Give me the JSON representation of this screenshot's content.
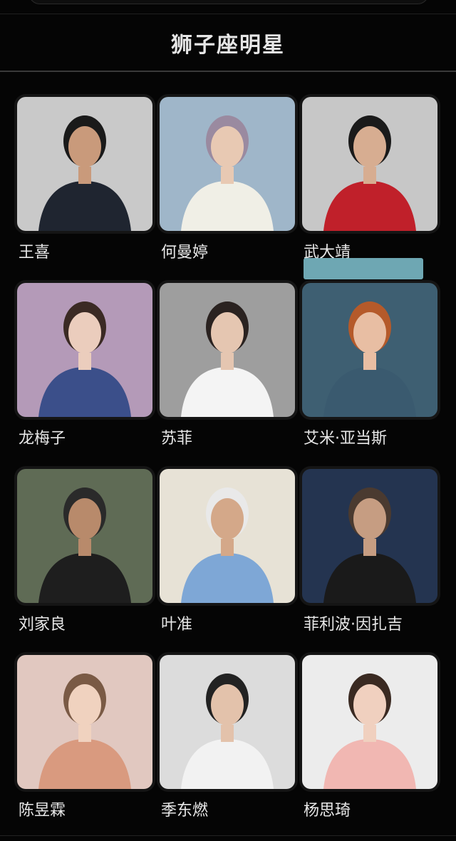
{
  "header": {
    "title": "狮子座明星"
  },
  "celebrities": [
    {
      "name": "王喜",
      "bg": "#c9c9c9",
      "cloth": "#1f2530",
      "skin": "#c99a7b",
      "hair": "#1a1a1a"
    },
    {
      "name": "何曼婷",
      "bg": "#9fb6c9",
      "cloth": "#f0efe6",
      "skin": "#e8c9b3",
      "hair": "#9a8aa0"
    },
    {
      "name": "武大靖",
      "bg": "#c7c7c7",
      "cloth": "#c0202a",
      "skin": "#d7ad91",
      "hair": "#1a1a1a"
    },
    {
      "name": "龙梅子",
      "bg": "#b49ab8",
      "cloth": "#3b4f8a",
      "skin": "#ebcdbd",
      "hair": "#3b2a24"
    },
    {
      "name": "苏菲",
      "bg": "#9e9e9e",
      "cloth": "#f4f4f4",
      "skin": "#e5c6b1",
      "hair": "#2a2220"
    },
    {
      "name": "艾米·亚当斯",
      "bg": "#3e5f72",
      "cloth": "#3a5a6f",
      "skin": "#e8bea3",
      "hair": "#b55a2a"
    },
    {
      "name": "刘家良",
      "bg": "#5f6b55",
      "cloth": "#1e1e1e",
      "skin": "#b88a6b",
      "hair": "#2a2a2a"
    },
    {
      "name": "叶准",
      "bg": "#e7e2d6",
      "cloth": "#7ea7d6",
      "skin": "#d4a889",
      "hair": "#e9e9e9"
    },
    {
      "name": "菲利波·因扎吉",
      "bg": "#243450",
      "cloth": "#1a1a1a",
      "skin": "#c69d82",
      "hair": "#4a3a30"
    },
    {
      "name": "陈昱霖",
      "bg": "#e1c8c0",
      "cloth": "#d99a7f",
      "skin": "#f0d2bf",
      "hair": "#7a5a45"
    },
    {
      "name": "季东燃",
      "bg": "#dcdcdc",
      "cloth": "#f2f2f2",
      "skin": "#e3c2ab",
      "hair": "#222222"
    },
    {
      "name": "杨思琦",
      "bg": "#ececec",
      "cloth": "#f1b7b2",
      "skin": "#f0d0bf",
      "hair": "#3a2a22"
    }
  ]
}
